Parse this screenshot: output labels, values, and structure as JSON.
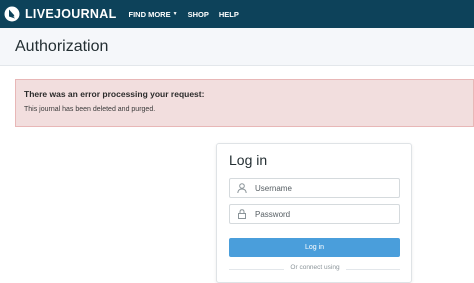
{
  "brand": {
    "logo_text": "LIVEJOURNAL"
  },
  "nav": {
    "items": [
      {
        "label": "FIND MORE",
        "has_dropdown": true
      },
      {
        "label": "SHOP",
        "has_dropdown": false
      },
      {
        "label": "HELP",
        "has_dropdown": false
      }
    ],
    "background": "#0d425a"
  },
  "page": {
    "title": "Authorization"
  },
  "error": {
    "title": "There was an error processing your request:",
    "message": "This journal has been deleted and purged.",
    "background": "#f2dede"
  },
  "login": {
    "title": "Log in",
    "username_placeholder": "Username",
    "username_icon": "user-icon",
    "password_placeholder": "Password",
    "password_icon": "lock-icon",
    "button_label": "Log in",
    "button_color": "#4a9edb",
    "connect_text": "Or connect using"
  }
}
